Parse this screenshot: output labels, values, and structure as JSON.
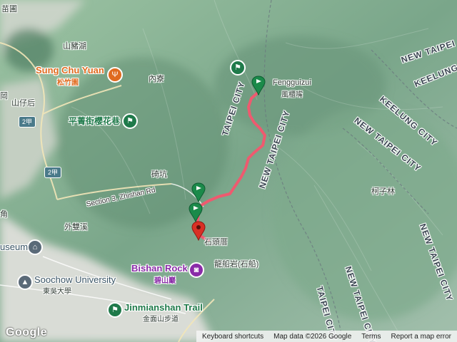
{
  "map": {
    "labels": {
      "miaopu": "苗圃",
      "shanzhuhu": "山豬湖",
      "sung_chu_yuan": "Sung Chu Yuan",
      "sung_chu_yuan_zh": "松竹園",
      "neiliao": "內寮",
      "shanzihou": "山仔后",
      "gang": "岡",
      "pingjing": "平菁街櫻花巷",
      "fengguizui": "Fengguizui",
      "fengguizui_zh": "風櫃嘴",
      "taipei_city_1": "TAIPEI CITY",
      "new_taipei_city_1": "NEW TAIPEI CITY",
      "new_taipei_top": "NEW TAIPEI",
      "keelung": "KEELUNG",
      "keelung_city": "KEELUNG CITY",
      "new_taipei_city_2": "NEW TAIPEI CITY",
      "new_taipei_city_3": "NEW TAIPEI CITY",
      "taipei_city_2": "TAIPEI CITY",
      "new_taipei_city_4": "NEW TAIPEI CITY",
      "kezilin": "柯子林",
      "weikeng": "碕坑",
      "section3": "Section 3, Zhishan Rd",
      "waishuangxi": "外雙溪",
      "jiao": "角",
      "shitouchu": "石頭厝",
      "bishan_rock": "Bishan Rock",
      "bishan_zh": "碧山巖",
      "longchuan": "龍船岩(石船)",
      "soochow": "Soochow University",
      "soochow_zh": "東吳大學",
      "useum": "useum",
      "jinmianshan": "Jinmianshan Trail",
      "jinmianshan_zh": "金面山步道",
      "route2": "2甲",
      "route2b": "2甲"
    },
    "bottom_bar": {
      "shortcuts": "Keyboard shortcuts",
      "mapdata": "Map data ©2026 Google",
      "terms": "Terms",
      "report": "Report a map error"
    },
    "logo": "Google",
    "colors": {
      "route": "#ee5a6f",
      "marker_green": "#1b8a4a",
      "marker_red": "#d93025",
      "poi_orange": "#e06b1f",
      "poi_green": "#1f7a4a",
      "poi_purple": "#8a2ca8"
    },
    "icons": [
      "restaurant-icon",
      "hiking-icon",
      "photo-icon",
      "university-icon",
      "museum-icon",
      "flag-marker-icon",
      "pin-marker-icon"
    ]
  }
}
